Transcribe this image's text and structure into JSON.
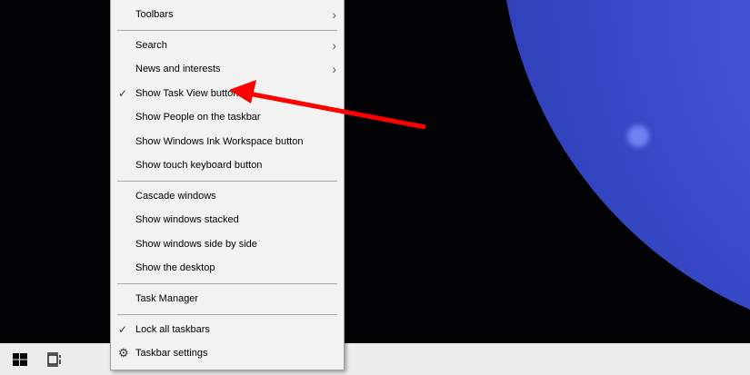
{
  "menu": {
    "items": [
      {
        "label": "Toolbars",
        "submenu": true,
        "checked": false
      },
      {
        "label": "Search",
        "submenu": true,
        "checked": false
      },
      {
        "label": "News and interests",
        "submenu": true,
        "checked": false
      },
      {
        "label": "Show Task View button",
        "submenu": false,
        "checked": true
      },
      {
        "label": "Show People on the taskbar",
        "submenu": false,
        "checked": false
      },
      {
        "label": "Show Windows Ink Workspace button",
        "submenu": false,
        "checked": false
      },
      {
        "label": "Show touch keyboard button",
        "submenu": false,
        "checked": false
      },
      {
        "label": "Cascade windows",
        "submenu": false,
        "checked": false
      },
      {
        "label": "Show windows stacked",
        "submenu": false,
        "checked": false
      },
      {
        "label": "Show windows side by side",
        "submenu": false,
        "checked": false
      },
      {
        "label": "Show the desktop",
        "submenu": false,
        "checked": false
      },
      {
        "label": "Task Manager",
        "submenu": false,
        "checked": false
      },
      {
        "label": "Lock all taskbars",
        "submenu": false,
        "checked": true
      },
      {
        "label": "Taskbar settings",
        "submenu": false,
        "checked": false,
        "icon": "gear-icon"
      }
    ]
  },
  "annotation_color": "#ff0000"
}
